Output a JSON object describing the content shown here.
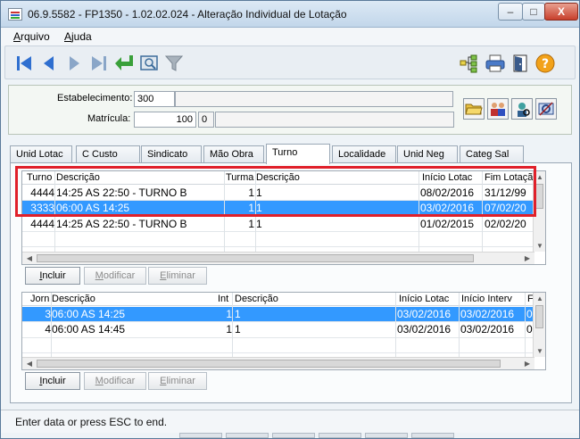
{
  "window": {
    "title": "06.9.5582 - FP1350 - 1.02.02.024 - Alteração Individual de Lotação",
    "close": "X",
    "minimize": "–",
    "maximize": "□"
  },
  "menu": [
    {
      "underline": "A",
      "rest": "rquivo"
    },
    {
      "underline": "A",
      "rest": "juda"
    }
  ],
  "header": {
    "estabelecimento_label": "Estabelecimento:",
    "estabelecimento_value": "300",
    "estabelecimento_desc": "",
    "matricula_label": "Matrícula:",
    "matricula_value": "100",
    "matricula_digit": "0",
    "matricula_name": ""
  },
  "tabs": [
    "Unid Lotac",
    "C Custo",
    "Sindicato",
    "Mão Obra",
    "Turno",
    "Localidade",
    "Unid Neg",
    "Categ Sal"
  ],
  "active_tab": "Turno",
  "grid1": {
    "headers": [
      "Turno",
      "Descrição",
      "Turma",
      "Descrição",
      "Início Lotac",
      "Fim Lotação"
    ],
    "rows": [
      {
        "turno": "4444",
        "desc": "14:25 AS 22:50 - TURNO B",
        "turma": "1",
        "desc2": "1",
        "inicio": "08/02/2016",
        "fim": "31/12/99"
      },
      {
        "turno": "3333",
        "desc": "06:00 AS 14:25",
        "turma": "1",
        "desc2": "1",
        "inicio": "03/02/2016",
        "fim": "07/02/20"
      },
      {
        "turno": "4444",
        "desc": "14:25 AS 22:50 - TURNO B",
        "turma": "1",
        "desc2": "1",
        "inicio": "01/02/2015",
        "fim": "02/02/20"
      }
    ],
    "selected_row": 1
  },
  "grid2": {
    "headers": [
      "Jorn",
      "Descrição",
      "Int",
      "Descrição",
      "Início Lotac",
      "Início Interv",
      "F"
    ],
    "rows": [
      {
        "jorn": "3",
        "desc": "06:00 AS 14:25",
        "int": "1",
        "desc2": "1",
        "inicio": "03/02/2016",
        "interv": "03/02/2016",
        "f": "0"
      },
      {
        "jorn": "4",
        "desc": "06:00 AS 14:45",
        "int": "1",
        "desc2": "1",
        "inicio": "03/02/2016",
        "interv": "03/02/2016",
        "f": "0"
      }
    ],
    "selected_row": 0
  },
  "buttons": {
    "incluir": {
      "underline": "I",
      "rest": "ncluir"
    },
    "modificar": {
      "underline": "M",
      "rest": "odificar"
    },
    "eliminar": {
      "underline": "E",
      "rest": "liminar"
    }
  },
  "status": {
    "text": "Enter data or press ESC to end."
  },
  "icons": {
    "toolbar": [
      "first-record-icon",
      "previous-record-icon",
      "next-record-icon",
      "last-record-icon",
      "confirm-enter-icon",
      "preview-icon",
      "filter-icon",
      "tree-icon",
      "print-icon",
      "exit-door-icon",
      "help-icon"
    ],
    "header": [
      "open-folder-icon",
      "users-icon",
      "user-search-icon",
      "settings-icon"
    ]
  },
  "colors": {
    "selection": "#3399ff",
    "highlight_frame": "#e0202a",
    "nav_blue": "#2f6fd0",
    "confirm_green": "#3aa03a",
    "help_orange": "#f2a21a"
  }
}
